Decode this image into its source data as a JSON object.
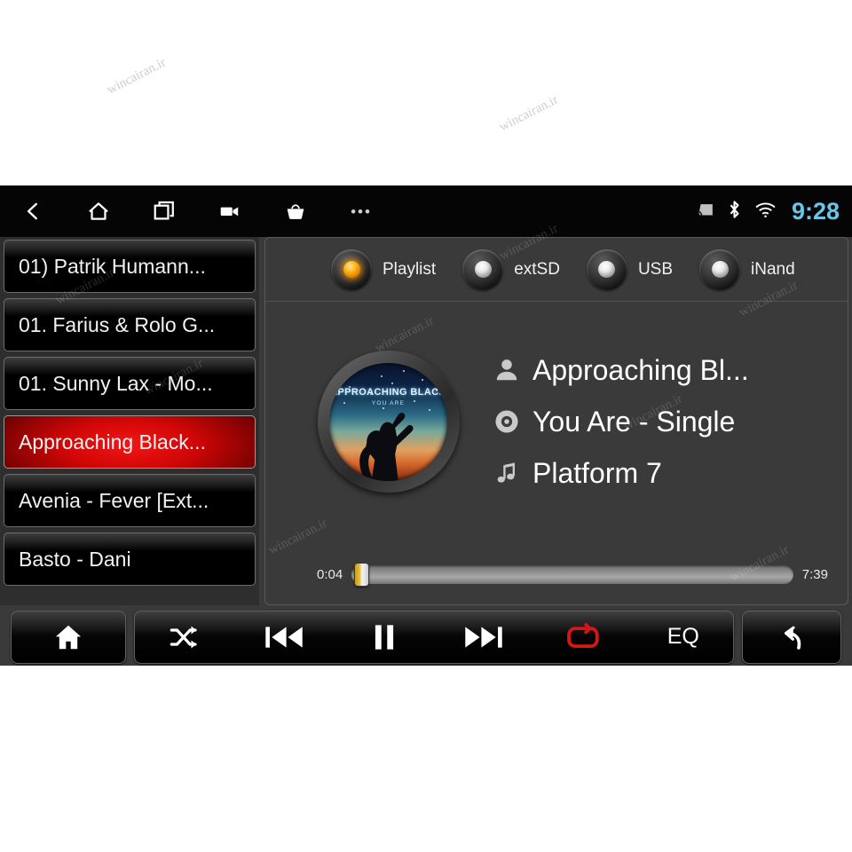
{
  "statusbar": {
    "nav": [
      {
        "name": "back",
        "icon": "chevron-left-icon"
      },
      {
        "name": "home",
        "icon": "home-outline-icon"
      },
      {
        "name": "recents",
        "icon": "recent-apps-icon"
      },
      {
        "name": "screen-record",
        "icon": "video-camera-icon"
      },
      {
        "name": "apps-basket",
        "icon": "basket-icon"
      },
      {
        "name": "more",
        "icon": "more-dots-icon"
      }
    ],
    "more_label": "•••",
    "indicators": [
      {
        "name": "cast",
        "icon": "cast-icon"
      },
      {
        "name": "bluetooth",
        "icon": "bluetooth-icon"
      },
      {
        "name": "wifi",
        "icon": "wifi-icon"
      }
    ],
    "clock": "9:28",
    "clock_color": "#69c6e8"
  },
  "playlist": {
    "tracks": [
      {
        "label": "01) Patrik Humann...",
        "selected": false
      },
      {
        "label": "01. Farius & Rolo G...",
        "selected": false
      },
      {
        "label": "01. Sunny Lax - Mo...",
        "selected": false
      },
      {
        "label": "Approaching Black...",
        "selected": true
      },
      {
        "label": "Avenia - Fever [Ext...",
        "selected": false
      },
      {
        "label": "Basto - Dani",
        "selected": false
      }
    ],
    "selected_color": "#d00606"
  },
  "sources": [
    {
      "label": "Playlist",
      "active": true
    },
    {
      "label": "extSD",
      "active": false
    },
    {
      "label": "USB",
      "active": false
    },
    {
      "label": "iNand",
      "active": false
    }
  ],
  "now_playing": {
    "artwork": {
      "title": "APPROACHING BLACK",
      "subtitle": "YOU ARE"
    },
    "rows": [
      {
        "icon": "artist-icon",
        "text": "Approaching Bl..."
      },
      {
        "icon": "album-disc-icon",
        "text": "You Are - Single"
      },
      {
        "icon": "music-note-icon",
        "text": "Platform 7"
      }
    ]
  },
  "seek": {
    "elapsed": "0:04",
    "duration": "7:39",
    "progress_percent": 1
  },
  "controls": {
    "home_label": "home-icon",
    "transport": [
      {
        "name": "shuffle",
        "icon": "shuffle-icon",
        "label": "",
        "active": false
      },
      {
        "name": "previous",
        "icon": "previous-track-icon",
        "label": "",
        "active": false
      },
      {
        "name": "play-pause",
        "icon": "pause-icon",
        "label": "",
        "active": false
      },
      {
        "name": "next",
        "icon": "next-track-icon",
        "label": "",
        "active": false
      },
      {
        "name": "repeat",
        "icon": "repeat-icon",
        "label": "",
        "active": true
      },
      {
        "name": "equalizer",
        "icon": "",
        "label": "EQ",
        "active": false
      }
    ],
    "repeat_active_color": "#d81616",
    "back_label": "back-arrow-icon"
  },
  "watermarks": [
    "wincairan.ir",
    "wincairan.ir",
    "wincairan.ir",
    "wincairan.ir",
    "wincairan.ir",
    "wincairan.ir",
    "wincairan.ir",
    "wincairan.ir",
    "wincairan.ir",
    "wincairan.ir",
    "wincairan.ir",
    "wincairan.ir"
  ]
}
